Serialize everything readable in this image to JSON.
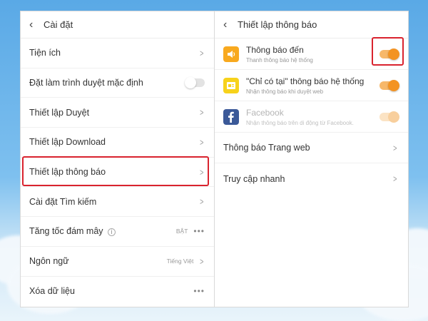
{
  "left": {
    "header": {
      "back_icon": "‹",
      "title": "Cài đặt"
    },
    "rows": [
      {
        "label": "Tiện ích"
      },
      {
        "label": "Đặt làm trình duyệt mặc định"
      },
      {
        "label": "Thiết lập Duyệt"
      },
      {
        "label": "Thiết lập Download"
      },
      {
        "label": "Thiết lập thông báo"
      },
      {
        "label": "Cài đặt Tìm kiếm"
      },
      {
        "label": "Tăng tốc đám mây",
        "value": "BẬT"
      },
      {
        "label": "Ngôn ngữ",
        "value": "Tiếng Việt"
      },
      {
        "label": "Xóa dữ liệu"
      }
    ]
  },
  "right": {
    "header": {
      "back_icon": "‹",
      "title": "Thiết lập thông báo"
    },
    "notifications": [
      {
        "title": "Thông báo đến",
        "subtitle": "Thanh thông báo hệ thống",
        "icon": "speaker-icon",
        "icon_color": "#f8a91f",
        "toggle": "on"
      },
      {
        "title": "\"Chỉ có tại\" thông báo hệ thống",
        "subtitle": "Nhận thông báo khi duyệt web",
        "icon": "card-icon",
        "icon_color": "#f7d21b",
        "toggle": "on"
      },
      {
        "title": "Facebook",
        "subtitle": "Nhận thông báo trên di động từ Facebook.",
        "icon": "facebook-icon",
        "icon_color": "#3b5998",
        "toggle": "dim"
      }
    ],
    "rows": [
      {
        "label": "Thông báo Trang web"
      },
      {
        "label": "Truy cập nhanh"
      }
    ]
  },
  "colors": {
    "highlight": "#d9232e",
    "toggle_on": "#f39322"
  }
}
